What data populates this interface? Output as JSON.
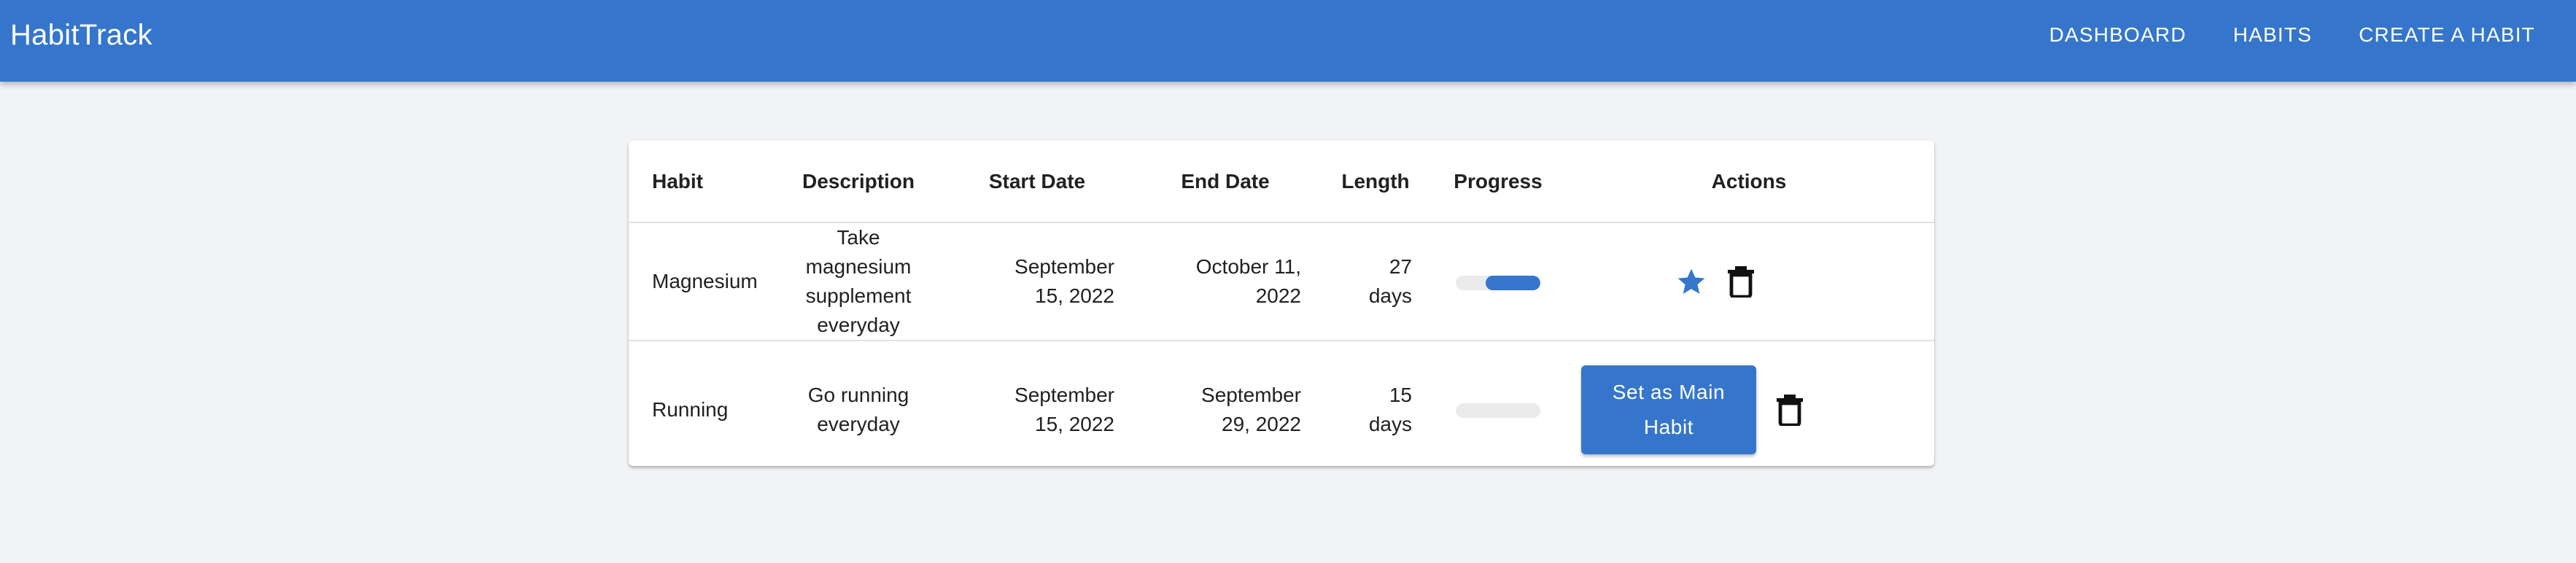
{
  "app": {
    "title": "HabitTrack"
  },
  "nav": {
    "items": [
      {
        "label": "DASHBOARD"
      },
      {
        "label": "HABITS"
      },
      {
        "label": "CREATE A HABIT"
      }
    ]
  },
  "table": {
    "headers": {
      "habit": "Habit",
      "description": "Description",
      "start_date": "Start Date",
      "end_date": "End Date",
      "length": "Length",
      "progress": "Progress",
      "actions": "Actions"
    },
    "rows": [
      {
        "habit": "Magnesium",
        "description": "Take magnesium supplement everyday",
        "start_date": "September 15, 2022",
        "end_date": "October 11, 2022",
        "length": "27 days",
        "progress": 0.65,
        "is_main": true,
        "actions": {
          "star_icon": "star-icon",
          "delete_icon": "trash-icon"
        }
      },
      {
        "habit": "Running",
        "description": "Go running everyday",
        "start_date": "September 15, 2022",
        "end_date": "September 29, 2022",
        "length": "15 days",
        "progress": 0,
        "is_main": false,
        "actions": {
          "main_button_label": "Set as Main Habit",
          "delete_icon": "trash-icon"
        }
      }
    ]
  },
  "colors": {
    "primary": "#3576cc",
    "background": "#f2f3f5",
    "track": "#ebebeb"
  }
}
